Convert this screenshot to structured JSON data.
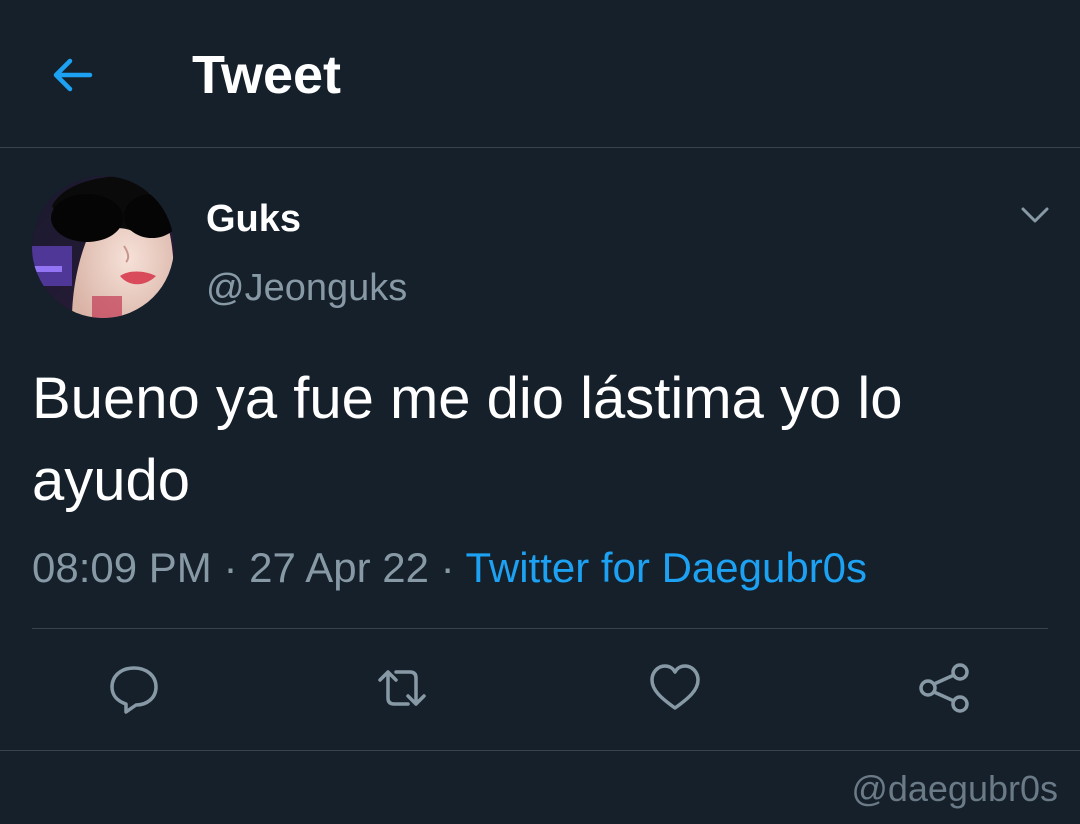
{
  "header": {
    "title": "Tweet",
    "back_icon": "arrow-left-icon"
  },
  "author": {
    "display_name": "Guks",
    "handle": "@Jeonguks"
  },
  "tweet": {
    "text": "Bueno ya fue me dio lástima yo lo ayudo",
    "time": "08:09 PM",
    "separator": "·",
    "date": "27 Apr 22",
    "source": "Twitter for Daegubr0s"
  },
  "actions": [
    {
      "name": "reply",
      "icon": "reply-icon"
    },
    {
      "name": "retweet",
      "icon": "retweet-icon"
    },
    {
      "name": "like",
      "icon": "heart-icon"
    },
    {
      "name": "share",
      "icon": "share-icon"
    }
  ],
  "watermark": "@daegubr0s",
  "colors": {
    "background": "#15202b",
    "accent": "#1da1f2",
    "secondary_text": "#8899a6",
    "divider": "#38444d"
  }
}
